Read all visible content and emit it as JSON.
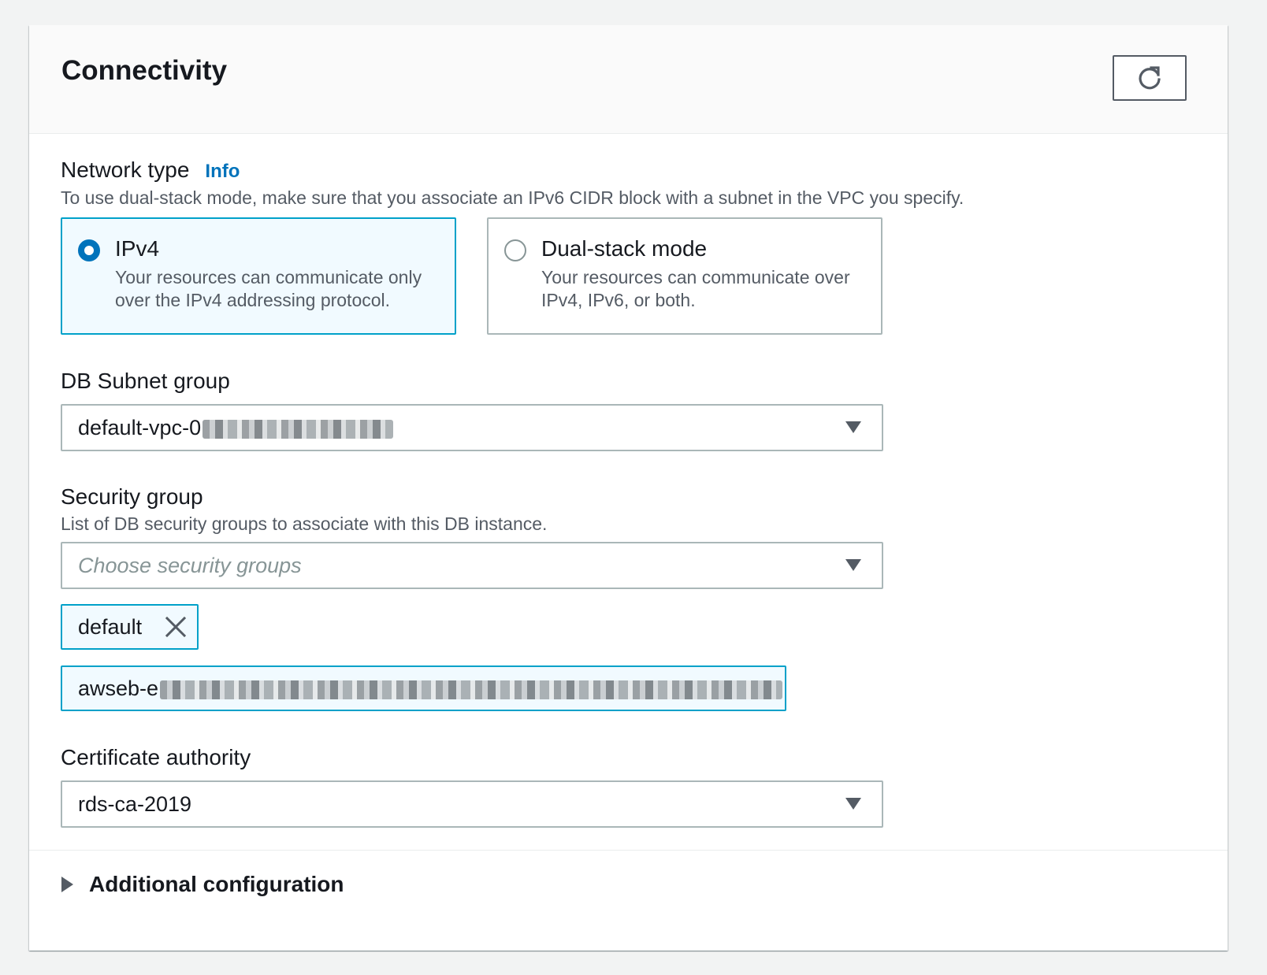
{
  "panel": {
    "title": "Connectivity",
    "refresh_icon": "refresh-icon"
  },
  "network_type": {
    "label": "Network type",
    "info_link": "Info",
    "description": "To use dual-stack mode, make sure that you associate an IPv6 CIDR block with a subnet in the VPC you specify.",
    "options": [
      {
        "title": "IPv4",
        "description": "Your resources can communicate only over the IPv4 addressing protocol.",
        "selected": true
      },
      {
        "title": "Dual-stack mode",
        "description": "Your resources can communicate over IPv4, IPv6, or both.",
        "selected": false
      }
    ]
  },
  "db_subnet_group": {
    "label": "DB Subnet group",
    "value": "default-vpc-0",
    "dropdown_icon": "caret-down-icon"
  },
  "security_group": {
    "label": "Security group",
    "description": "List of DB security groups to associate with this DB instance.",
    "placeholder": "Choose security groups",
    "tokens": [
      {
        "label": "default",
        "remove_icon": "close-icon"
      },
      {
        "label": "awseb-e",
        "remove_icon": "close-icon"
      }
    ]
  },
  "certificate_authority": {
    "label": "Certificate authority",
    "value": "rds-ca-2019"
  },
  "additional_configuration": {
    "label": "Additional configuration",
    "expanded": false
  },
  "colors": {
    "accent": "#0073bb",
    "selected_border": "#00a1c9",
    "selected_background": "#f1faff",
    "text_primary": "#16191f",
    "text_secondary": "#545b64"
  }
}
